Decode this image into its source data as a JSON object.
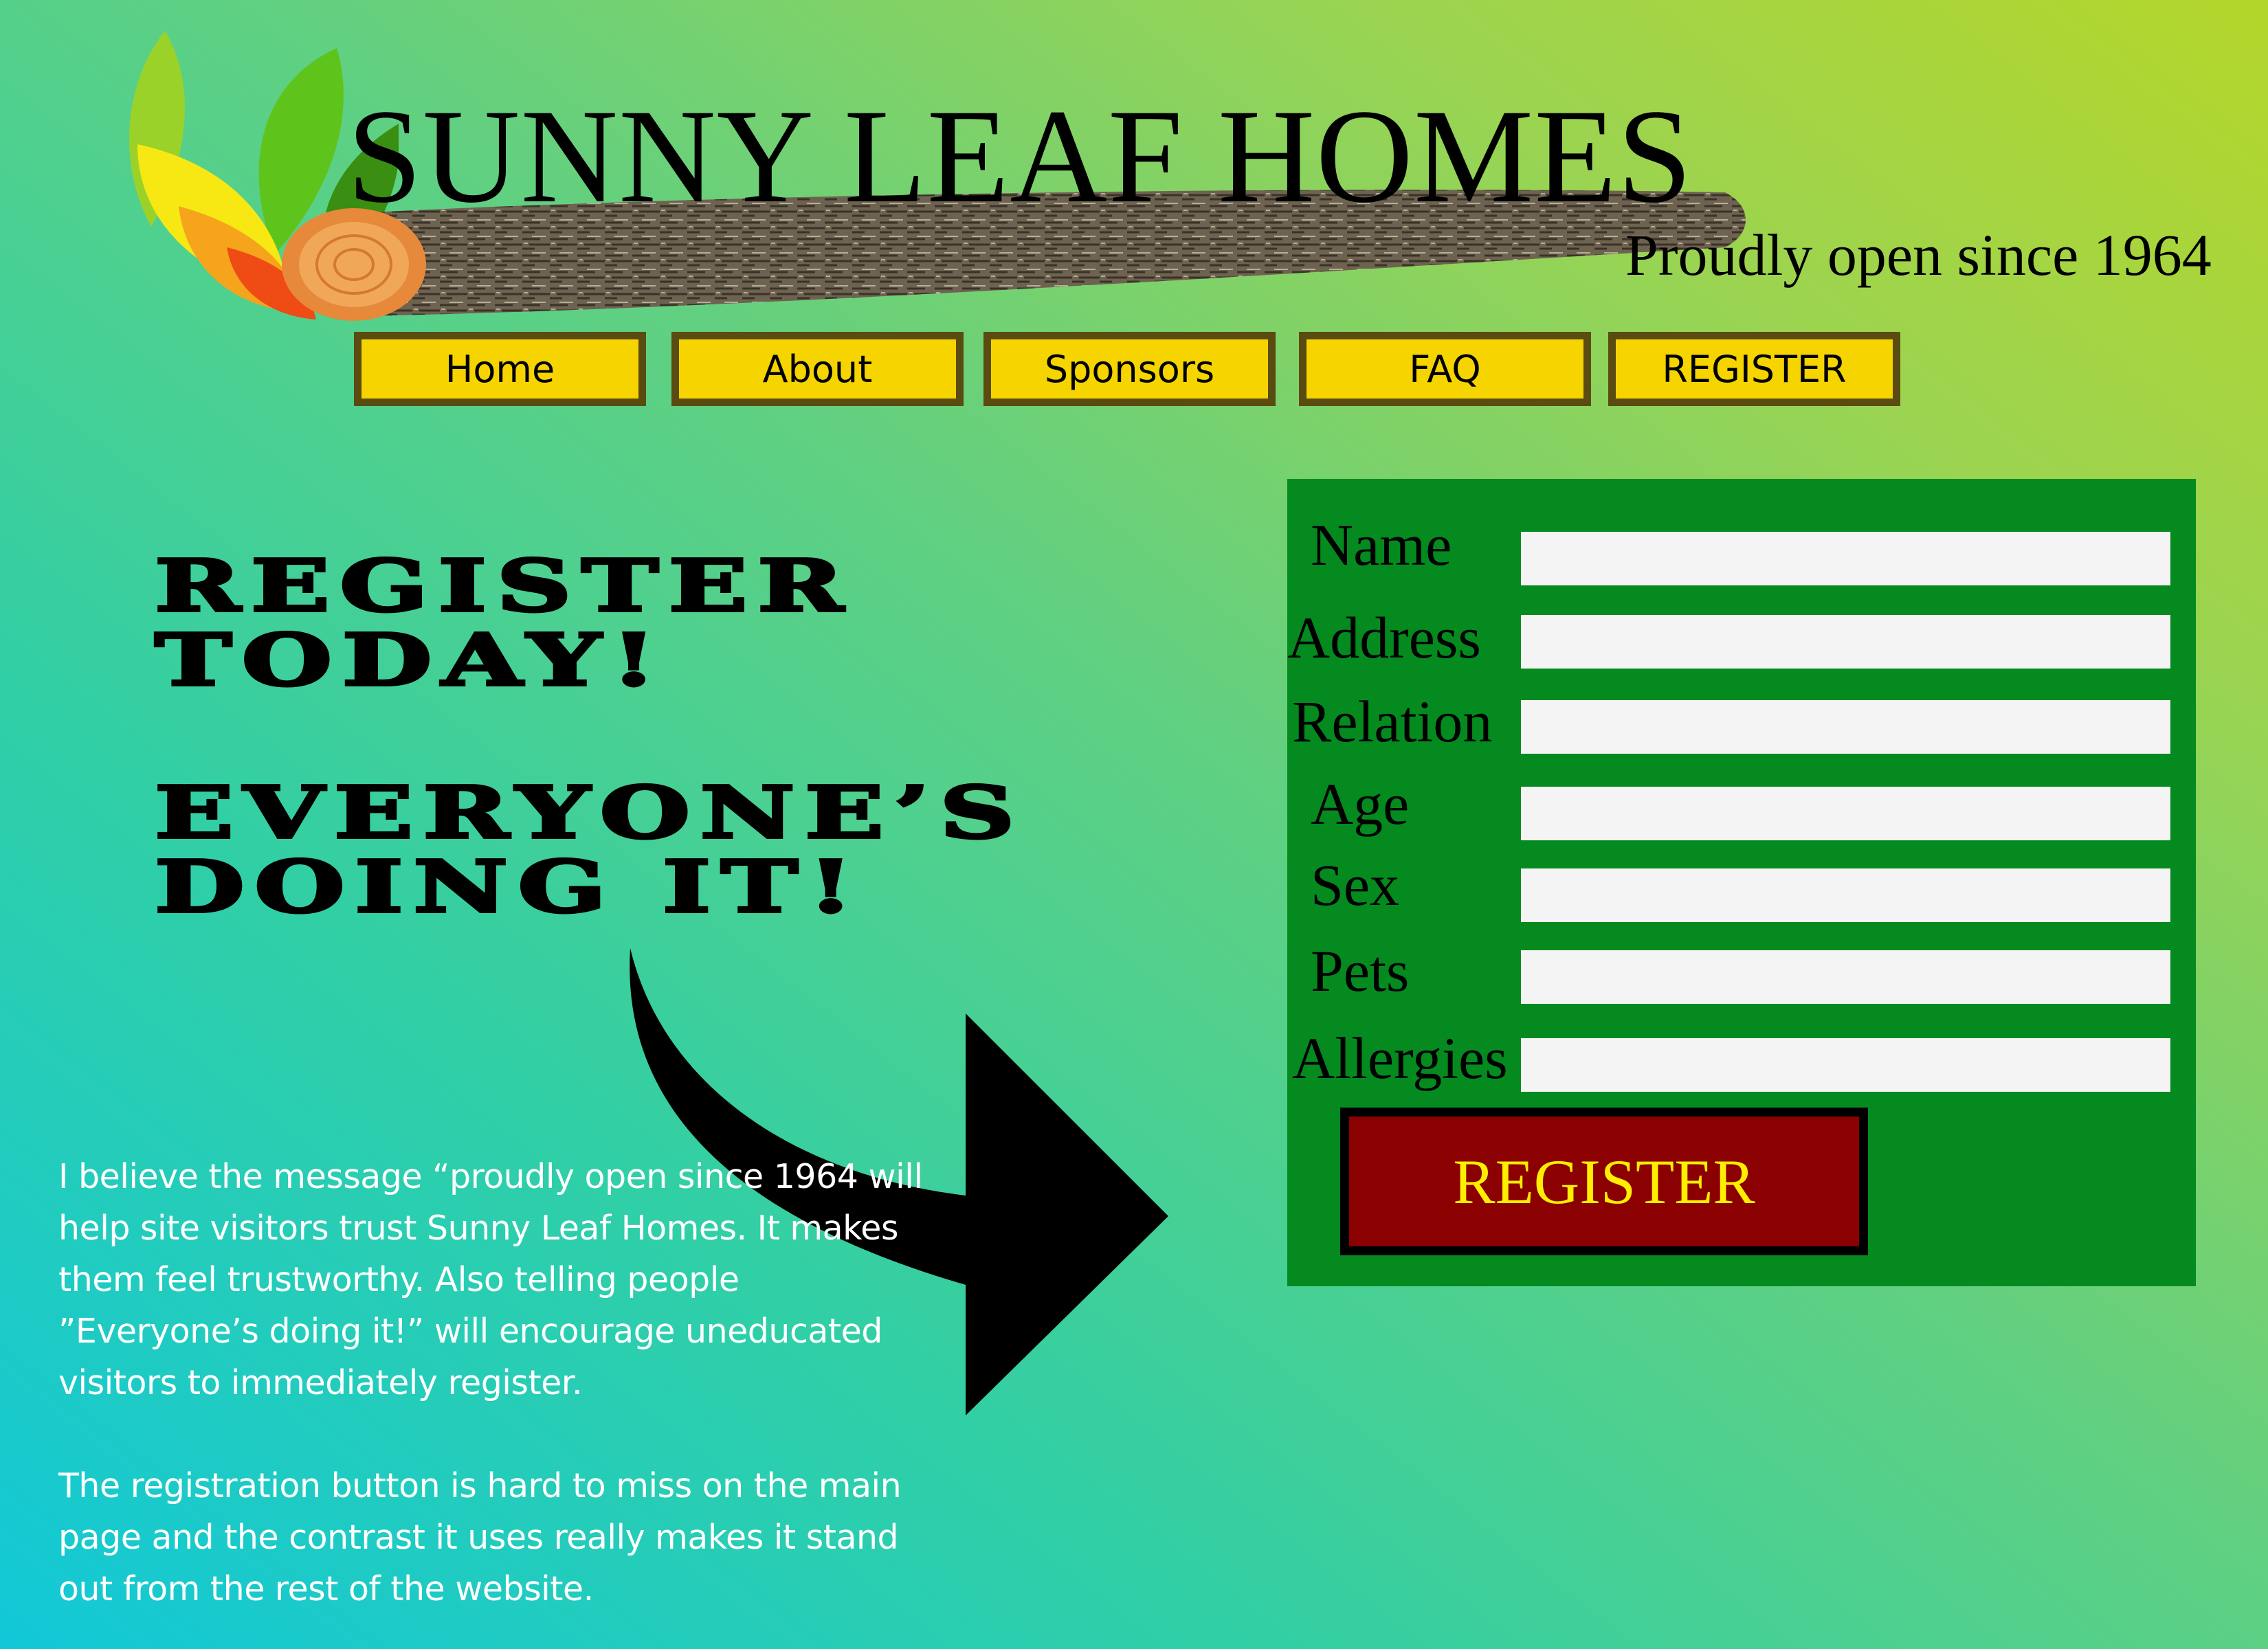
{
  "header": {
    "title": "SUNNY LEAF HOMES",
    "tagline": "Proudly open since 1964"
  },
  "nav": {
    "items": [
      {
        "label": "Home"
      },
      {
        "label": "About"
      },
      {
        "label": "Sponsors"
      },
      {
        "label": "FAQ"
      },
      {
        "label": "REGISTER"
      }
    ]
  },
  "headline": {
    "line1": "REGISTER",
    "line2": "TODAY!",
    "line3": "EVERYONE’S",
    "line4": "DOING IT!"
  },
  "commentary": {
    "paragraph1": "I believe the message “proudly open since 1964 will help site visitors trust Sunny Leaf Homes.  It makes them feel trustworthy.  Also telling people ”Everyone’s doing it!” will encourage uneducated visitors to immediately register.",
    "paragraph2": "The registration button is hard to miss on the main page and the contrast it uses really makes it stand out from the rest of the website."
  },
  "form": {
    "fields": [
      {
        "label": "Name",
        "value": ""
      },
      {
        "label": "Address",
        "value": ""
      },
      {
        "label": "Relation",
        "value": ""
      },
      {
        "label": "Age",
        "value": ""
      },
      {
        "label": "Sex",
        "value": ""
      },
      {
        "label": "Pets",
        "value": ""
      },
      {
        "label": "Allergies",
        "value": ""
      }
    ],
    "submit_label": "REGISTER"
  },
  "colors": {
    "nav_button": "#f5d400",
    "nav_border": "#5a4c10",
    "form_panel": "#048a1e",
    "submit_button": "#8b0000",
    "submit_text": "#ffee00",
    "commentary_text": "#ffffff"
  },
  "icons": {
    "logo": "leaf-logo",
    "log": "wooden-log",
    "arrow": "curved-arrow-right"
  }
}
